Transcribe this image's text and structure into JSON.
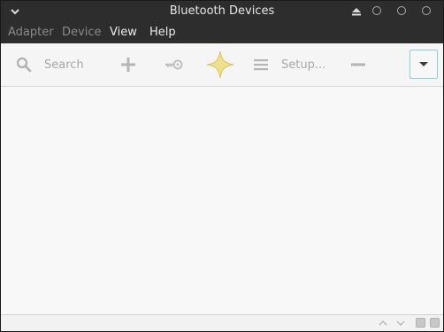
{
  "window": {
    "title": "Bluetooth Devices"
  },
  "menubar": {
    "items": [
      {
        "label": "Adapter",
        "enabled": false
      },
      {
        "label": "Device",
        "enabled": false
      },
      {
        "label": "View",
        "enabled": true
      },
      {
        "label": "Help",
        "enabled": true
      }
    ]
  },
  "toolbar": {
    "search_label": "Search",
    "setup_label": "Setup...",
    "icons": [
      "search-icon",
      "add-icon",
      "key-icon",
      "star-icon",
      "menu-lines-icon",
      "remove-icon",
      "chevron-down-icon"
    ]
  },
  "colors": {
    "titlebar_bg": "#2d2d2d",
    "toolbar_bg": "#f5f5f5",
    "star": "#f0e08a",
    "focus_border": "#7fd6cf"
  }
}
